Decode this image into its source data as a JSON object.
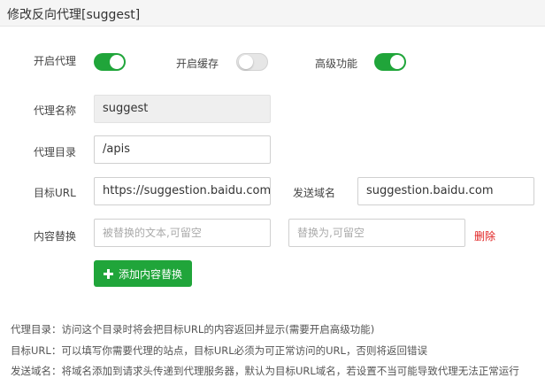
{
  "header": {
    "title": "修改反向代理[suggest]"
  },
  "toggles": [
    {
      "label": "开启代理",
      "on": true
    },
    {
      "label": "开启缓存",
      "on": false
    },
    {
      "label": "高级功能",
      "on": true
    }
  ],
  "form": {
    "proxy_name_label": "代理名称",
    "proxy_name_value": "suggest",
    "proxy_dir_label": "代理目录",
    "proxy_dir_value": "/apis",
    "target_url_label": "目标URL",
    "target_url_value": "https://suggestion.baidu.com",
    "send_domain_label": "发送域名",
    "send_domain_value": "suggestion.baidu.com",
    "replace_label": "内容替换",
    "replace_from_placeholder": "被替换的文本,可留空",
    "replace_to_placeholder": "替换为,可留空",
    "delete_label": "删除",
    "add_button_label": "添加内容替换"
  },
  "help": [
    "代理目录：访问这个目录时将会把目标URL的内容返回并显示(需要开启高级功能)",
    "目标URL：可以填写你需要代理的站点，目标URL必须为可正常访问的URL，否则将返回错误",
    "发送域名：将域名添加到请求头传递到代理服务器，默认为目标URL域名，若设置不当可能导致代理无法正常运行"
  ],
  "colors": {
    "accent": "#20a53a",
    "danger": "#e02020",
    "header_bg": "#f5f5f5"
  }
}
